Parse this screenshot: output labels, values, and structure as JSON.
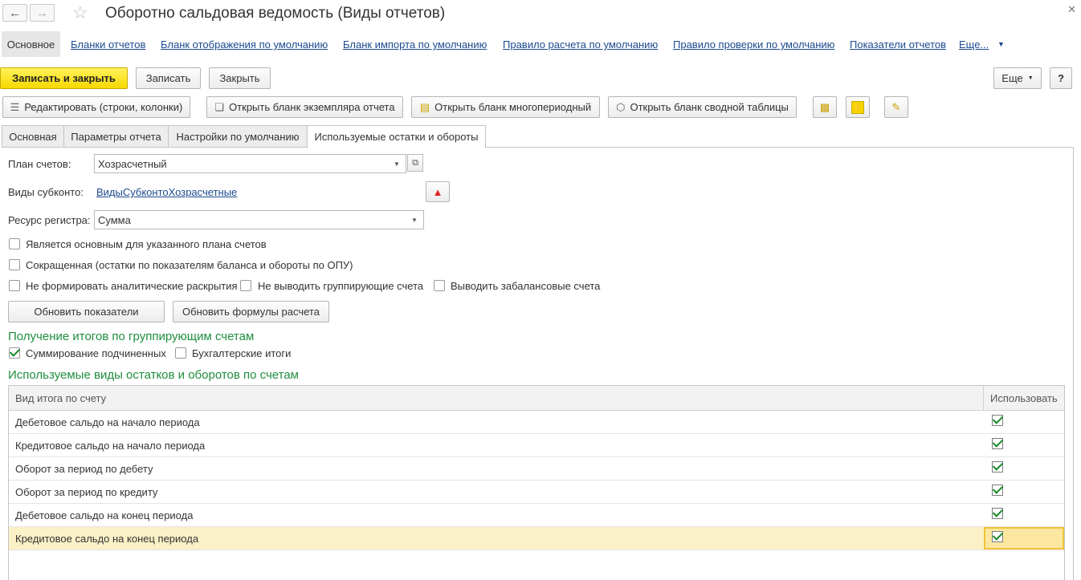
{
  "window": {
    "title": "Оборотно сальдовая ведомость (Виды отчетов)"
  },
  "top_nav": {
    "main": "Основное",
    "links": [
      "Бланки отчетов",
      "Бланк отображения по умолчанию",
      "Бланк импорта по умолчанию",
      "Правило расчета по умолчанию",
      "Правило проверки по умолчанию",
      "Показатели отчетов",
      "Еще..."
    ]
  },
  "toolbar": {
    "save_close": "Записать и закрыть",
    "save": "Записать",
    "close": "Закрыть",
    "more": "Еще",
    "help": "?"
  },
  "actions": {
    "edit": "Редактировать (строки, колонки)",
    "open_instance": "Открыть бланк экземпляра отчета",
    "open_multi": "Открыть бланк многопериодный",
    "open_pivot": "Открыть бланк сводной таблицы"
  },
  "tabs": [
    "Основная",
    "Параметры отчета",
    "Настройки по умолчанию",
    "Используемые остатки и обороты"
  ],
  "form": {
    "chart_label": "План счетов:",
    "chart_value": "Хозрасчетный",
    "subconto_label": "Виды субконто:",
    "subconto_link": "ВидыСубконтоХозрасчетные",
    "resource_label": "Ресурс регистра:",
    "resource_value": "Сумма",
    "cb_main": "Является основным для указанного плана счетов",
    "cb_short": "Сокращенная (остатки по показателям баланса и обороты по ОПУ)",
    "cb_no_analytics": "Не формировать аналитические раскрытия",
    "cb_no_group": "Не выводить группирующие счета",
    "cb_offbalance": "Выводить забалансовые счета",
    "btn_update_indicators": "Обновить показатели",
    "btn_update_formulas": "Обновить формулы расчета"
  },
  "totals_section": {
    "title": "Получение итогов по группирующим счетам",
    "sum_sub": "Суммирование подчиненных",
    "acc_totals": "Бухгалтерские итоги"
  },
  "table_section": {
    "title": "Используемые виды остатков и оборотов по счетам",
    "col_kind": "Вид итога по счету",
    "col_use": "Использовать",
    "rows": [
      "Дебетовое сальдо на начало периода",
      "Кредитовое сальдо на начало периода",
      "Оборот за период по дебету",
      "Оборот за период по кредиту",
      "Дебетовое сальдо на конец периода",
      "Кредитовое сальдо на конец периода"
    ]
  }
}
